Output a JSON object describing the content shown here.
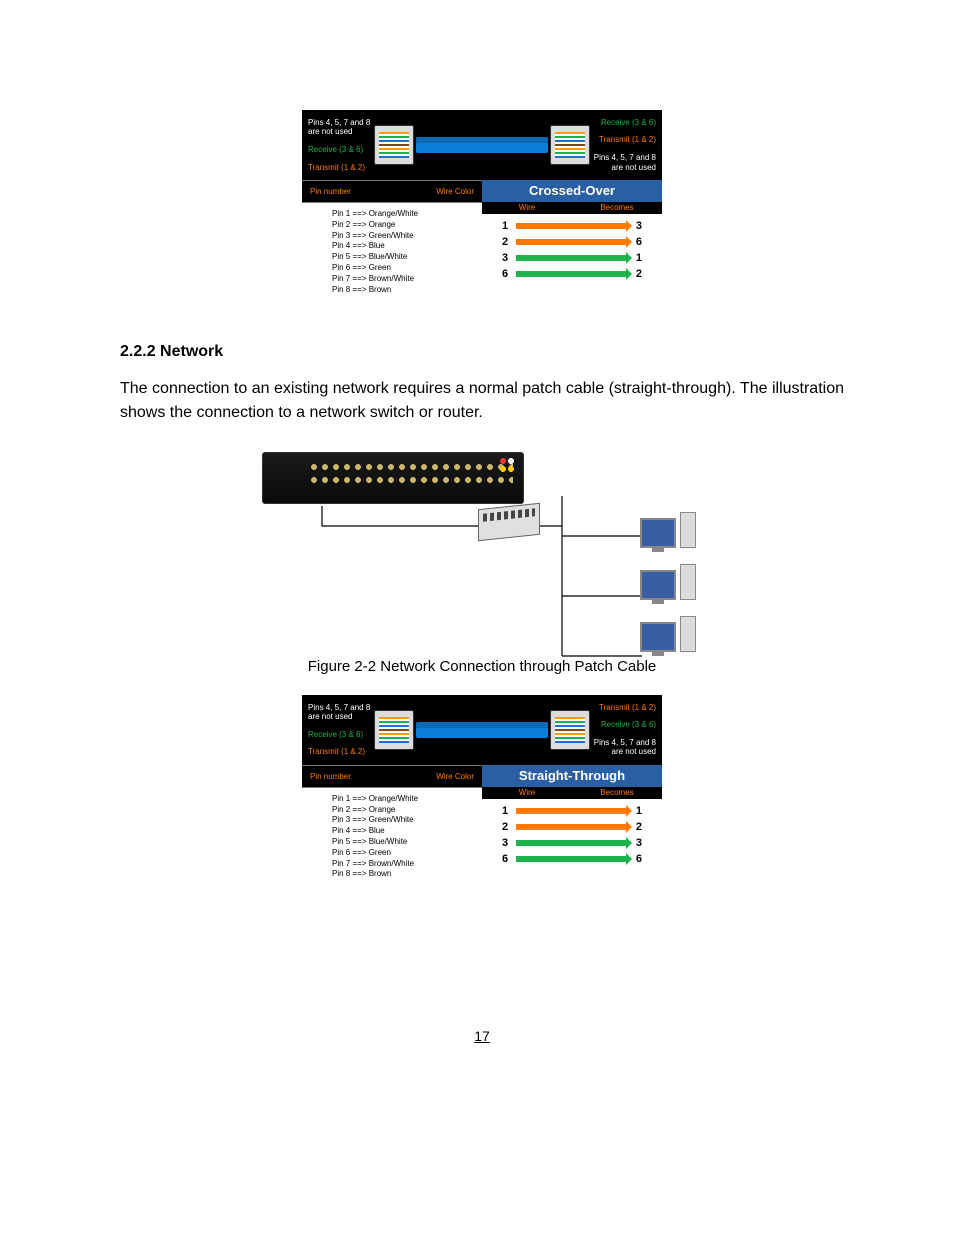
{
  "sections": {
    "network_title": "2.2.2 Network",
    "network_body": "The connection to an existing network requires a normal patch cable (straight-through). The illustration shows the connection to a network switch or router."
  },
  "captions": {
    "fig2": "Figure 2-2 Network Connection through Patch Cable"
  },
  "pinout_labels": {
    "unused": "Pins 4, 5, 7 and 8\nare not used",
    "receive": "Receive (3 & 6)",
    "transmit": "Transmit (1 & 2)"
  },
  "pin_table": {
    "hdr_pin": "Pin number",
    "hdr_color": "Wire Color",
    "rows": [
      "Pin 1 ==> Orange/White",
      "Pin 2 ==> Orange",
      "Pin 3 ==> Green/White",
      "Pin 4 ==> Blue",
      "Pin 5 ==> Blue/White",
      "Pin 6 ==> Green",
      "Pin 7 ==> Brown/White",
      "Pin 8 ==> Brown"
    ]
  },
  "crossover": {
    "title": "Crossed-Over",
    "sub_wire": "Wire",
    "sub_becomes": "Becomes",
    "map": [
      {
        "from": "1",
        "to": "3",
        "color": "orange"
      },
      {
        "from": "2",
        "to": "6",
        "color": "orange"
      },
      {
        "from": "3",
        "to": "1",
        "color": "green"
      },
      {
        "from": "6",
        "to": "2",
        "color": "green"
      }
    ]
  },
  "straight": {
    "title": "Straight-Through",
    "sub_wire": "Wire",
    "sub_becomes": "Becomes",
    "map": [
      {
        "from": "1",
        "to": "1",
        "color": "orange"
      },
      {
        "from": "2",
        "to": "2",
        "color": "orange"
      },
      {
        "from": "3",
        "to": "3",
        "color": "green"
      },
      {
        "from": "6",
        "to": "6",
        "color": "green"
      }
    ]
  },
  "page_number": "17"
}
